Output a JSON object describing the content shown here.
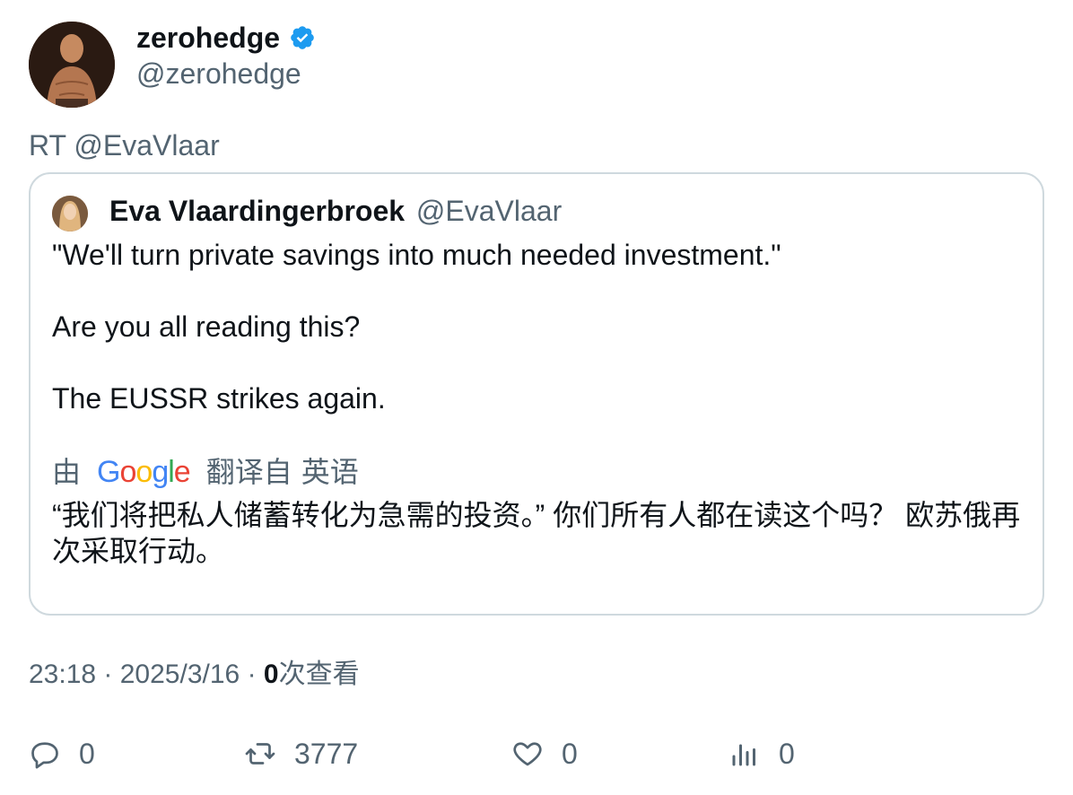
{
  "author": {
    "display_name": "zerohedge",
    "handle": "@zerohedge",
    "verified": true,
    "badge_color": "#1d9bf0"
  },
  "retweet_label": "RT @EvaVlaar",
  "quoted": {
    "display_name": "Eva Vlaardingerbroek",
    "handle": "@EvaVlaar",
    "text_lines": [
      "\"We'll turn private savings into much needed investment.\"",
      "Are you all reading this?",
      "The EUSSR strikes again."
    ],
    "translation": {
      "prefix": "由",
      "provider_letters": [
        "G",
        "o",
        "o",
        "g",
        "l",
        "e"
      ],
      "from_label": "翻译自",
      "language": "英语",
      "text": "“我们将把私人储蓄转化为急需的投资。” 你们所有人都在读这个吗？ 欧苏俄再次采取行动。"
    }
  },
  "meta": {
    "time": "23:18",
    "date": "2025/3/16",
    "views_count": "0",
    "views_label": "次查看"
  },
  "actions": {
    "reply_count": "0",
    "retweet_count": "3777",
    "like_count": "0",
    "views_count": "0"
  },
  "colors": {
    "text": "#0f1419",
    "secondary": "#536471",
    "border": "#cfd9de"
  }
}
